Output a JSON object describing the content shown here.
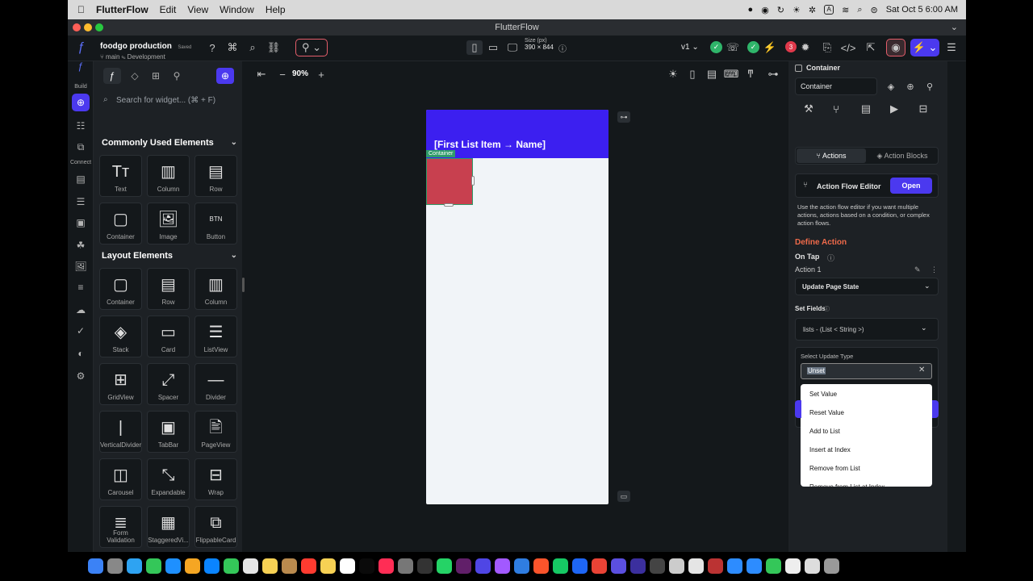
{
  "menubar": {
    "app": "FlutterFlow",
    "items": [
      "Edit",
      "View",
      "Window",
      "Help"
    ],
    "datetime": "Sat Oct 5  6:00 AM",
    "a_icon": "A"
  },
  "window": {
    "title": "FlutterFlow"
  },
  "topbar": {
    "project_name": "foodgo production",
    "saved": "Saved",
    "branch": "main",
    "env": "Development",
    "size_label": "Size (px)",
    "size_value": "390 × 844",
    "version": "v1",
    "badge": "3"
  },
  "rail": {
    "build": "Build",
    "connect": "Connect"
  },
  "widgets": {
    "search_placeholder": "Search for widget... (⌘ + F)",
    "common_title": "Commonly Used Elements",
    "common": [
      {
        "glyph": "Tт",
        "label": "Text"
      },
      {
        "glyph": "▥",
        "label": "Column"
      },
      {
        "glyph": "▤",
        "label": "Row"
      },
      {
        "glyph": "▢",
        "label": "Container"
      },
      {
        "glyph": "🖼",
        "label": "Image"
      },
      {
        "glyph": "BTN",
        "label": "Button"
      }
    ],
    "layout_title": "Layout Elements",
    "layout": [
      {
        "glyph": "▢",
        "label": "Container"
      },
      {
        "glyph": "▤",
        "label": "Row"
      },
      {
        "glyph": "▥",
        "label": "Column"
      },
      {
        "glyph": "◈",
        "label": "Stack"
      },
      {
        "glyph": "▭",
        "label": "Card"
      },
      {
        "glyph": "☰",
        "label": "ListView"
      },
      {
        "glyph": "⊞",
        "label": "GridView"
      },
      {
        "glyph": "⤢",
        "label": "Spacer"
      },
      {
        "glyph": "—",
        "label": "Divider"
      },
      {
        "glyph": "|",
        "label": "VerticalDivider"
      },
      {
        "glyph": "▣",
        "label": "TabBar"
      },
      {
        "glyph": "🖹",
        "label": "PageView"
      },
      {
        "glyph": "◫",
        "label": "Carousel"
      },
      {
        "glyph": "⤡",
        "label": "Expandable"
      },
      {
        "glyph": "⊟",
        "label": "Wrap"
      },
      {
        "glyph": "≣",
        "label": "Form Validation"
      },
      {
        "glyph": "▦",
        "label": "StaggeredVi..."
      },
      {
        "glyph": "⧉",
        "label": "FlippableCard"
      }
    ]
  },
  "canvas": {
    "zoom": "90%",
    "appbar_title": "[First List Item → Name]",
    "container_tag": "Container"
  },
  "props": {
    "header": "Container",
    "name_value": "Container",
    "tab_actions": "Actions",
    "tab_action_blocks": "Action Blocks",
    "afe_title": "Action Flow Editor",
    "afe_button": "Open",
    "afe_desc": "Use the action flow editor if you want multiple actions, actions based on a condition, or complex action flows.",
    "define_action": "Define Action",
    "on_tap": "On Tap",
    "action1": "Action 1",
    "action_type": "Update Page State",
    "set_fields": "Set Fields",
    "field": "lists - (List < String >)",
    "select_update_type": "Select Update Type",
    "update_type_value": "Unset",
    "options": [
      "Set Value",
      "Reset Value",
      "Add to List",
      "Insert at Index",
      "Remove from List",
      "Remove from List at Index"
    ],
    "colors": {
      "accent": "#4b39ef",
      "define": "#ef6a4a",
      "green": "#2f9c6a"
    }
  }
}
